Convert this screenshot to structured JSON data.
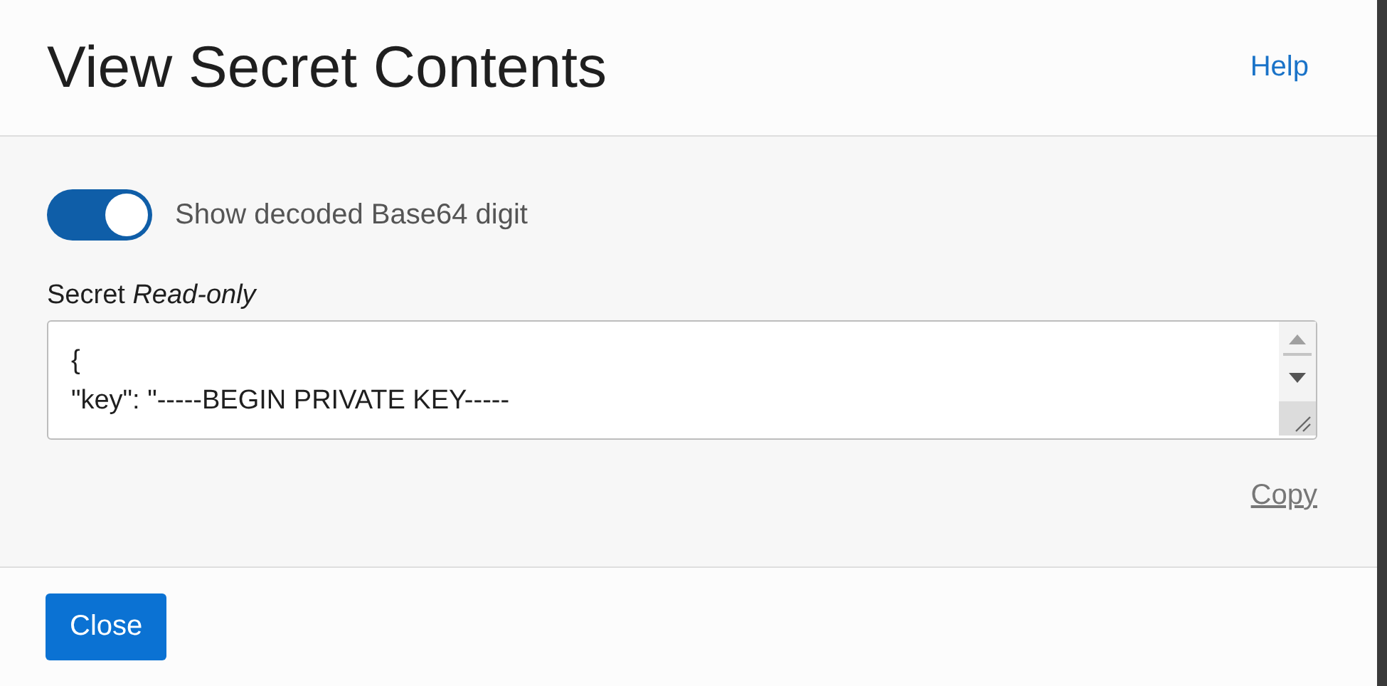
{
  "dialog": {
    "title": "View Secret Contents",
    "help_link": "Help"
  },
  "toggle": {
    "label": "Show decoded Base64 digit",
    "on": true
  },
  "secret_field": {
    "label": "Secret *Read-only*",
    "lines": [
      "{",
      "\"key\": \"-----BEGIN PRIVATE KEY-----"
    ]
  },
  "copy_link": "Copy",
  "buttons": [
    "Close"
  ]
}
